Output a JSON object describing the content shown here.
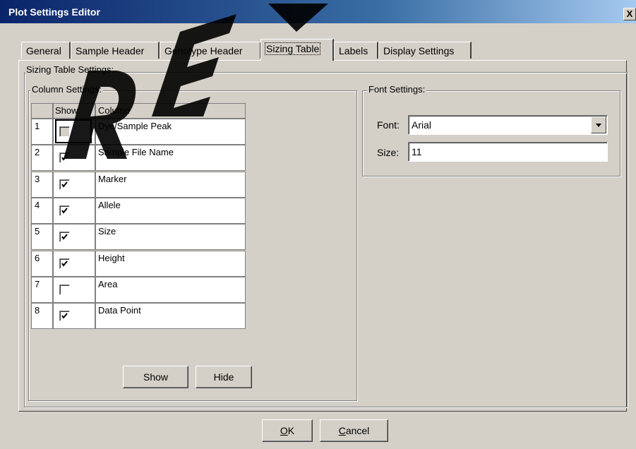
{
  "window": {
    "title": "Plot Settings Editor",
    "close": "X"
  },
  "tabs": [
    "General",
    "Sample Header",
    "Genotype Header",
    "Sizing Table",
    "Labels",
    "Display Settings"
  ],
  "groups": {
    "sizing": "Sizing Table Settings:",
    "column": "Column Settings:",
    "font": "Font Settings:"
  },
  "table": {
    "headers": [
      "Show",
      "Column"
    ],
    "rows": [
      {
        "index": "1",
        "checked": false,
        "name": "Dye/Sample Peak"
      },
      {
        "index": "2",
        "checked": true,
        "name": "Sample File Name"
      },
      {
        "index": "3",
        "checked": true,
        "name": "Marker"
      },
      {
        "index": "4",
        "checked": true,
        "name": "Allele"
      },
      {
        "index": "5",
        "checked": true,
        "name": "Size"
      },
      {
        "index": "6",
        "checked": true,
        "name": "Height"
      },
      {
        "index": "7",
        "checked": false,
        "name": "Area"
      },
      {
        "index": "8",
        "checked": true,
        "name": "Data Point"
      }
    ]
  },
  "buttons": {
    "show": "Show",
    "hide": "Hide",
    "ok_underline": "O",
    "ok_rest": "K",
    "cancel_underline": "C",
    "cancel_rest": "ancel"
  },
  "font": {
    "font_label": "Font:",
    "font_value": "Arial",
    "size_label": "Size:",
    "size_value": "11"
  }
}
